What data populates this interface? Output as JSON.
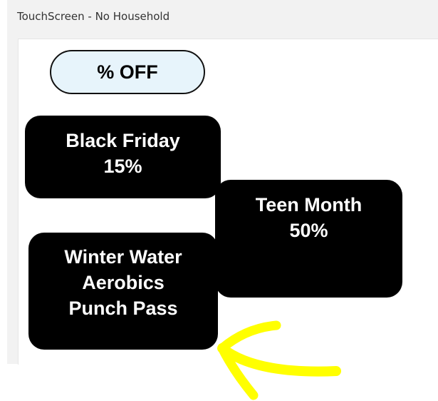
{
  "window": {
    "title": "TouchScreen - No Household"
  },
  "category_button": {
    "label": "% OFF"
  },
  "discount_tiles": [
    {
      "lines": [
        "Black Friday",
        "15%"
      ]
    },
    {
      "lines": [
        "Teen Month",
        "50%"
      ]
    },
    {
      "lines": [
        "Winter Water",
        "Aerobics",
        "Punch Pass"
      ]
    }
  ],
  "annotation": {
    "arrow_color": "#ffff00",
    "icon": "arrow-annotation-icon"
  }
}
